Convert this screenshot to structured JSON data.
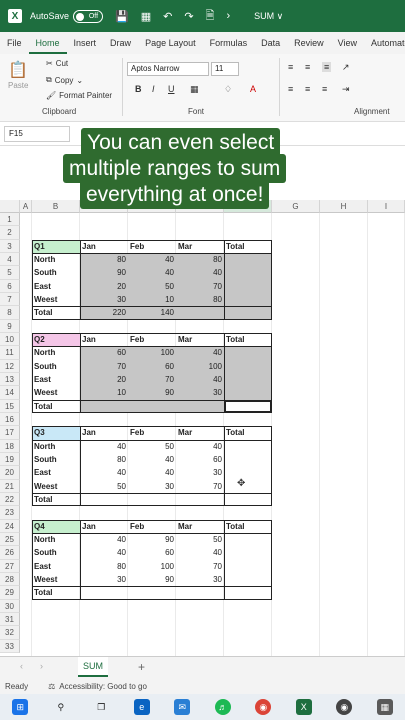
{
  "titlebar": {
    "autosave_label": "AutoSave",
    "autosave_state": "Off",
    "file_name": "SUM ∨"
  },
  "tabs": [
    "File",
    "Home",
    "Insert",
    "Draw",
    "Page Layout",
    "Formulas",
    "Data",
    "Review",
    "View",
    "Automate"
  ],
  "ribbon": {
    "paste": "Paste",
    "cut": "Cut",
    "copy": "Copy",
    "format_painter": "Format Painter",
    "clipboard_label": "Clipboard",
    "font_name": "Aptos Narrow",
    "font_size": "11",
    "font_label": "Font",
    "alignment_label": "Alignment",
    "bold": "B",
    "italic": "I",
    "underline": "U"
  },
  "namebox": "F15",
  "caption": [
    "You can even select",
    "multiple ranges to sum",
    "everything at once!"
  ],
  "columns": [
    "A",
    "B",
    "C",
    "D",
    "E",
    "F",
    "G",
    "H",
    "I"
  ],
  "rows": [
    "1",
    "2",
    "3",
    "4",
    "5",
    "6",
    "7",
    "8",
    "9",
    "10",
    "11",
    "12",
    "13",
    "14",
    "15",
    "16",
    "17",
    "18",
    "19",
    "20",
    "21",
    "22",
    "23",
    "24",
    "25",
    "26",
    "27",
    "28",
    "29",
    "30",
    "31",
    "32",
    "33"
  ],
  "headers": {
    "jan": "Jan",
    "feb": "Feb",
    "mar": "Mar",
    "total": "Total"
  },
  "blocks": [
    {
      "quarter": "Q1",
      "color": "#c6efce",
      "rows": [
        {
          "label": "North",
          "jan": "80",
          "feb": "40",
          "mar": "80"
        },
        {
          "label": "South",
          "jan": "90",
          "feb": "40",
          "mar": "40"
        },
        {
          "label": "East",
          "jan": "20",
          "feb": "50",
          "mar": "70"
        },
        {
          "label": "Weest",
          "jan": "30",
          "feb": "10",
          "mar": "80"
        }
      ],
      "total_row": {
        "label": "Total",
        "jan": "220",
        "feb": "140",
        "mar": ""
      }
    },
    {
      "quarter": "Q2",
      "color": "#f4c6e7",
      "rows": [
        {
          "label": "North",
          "jan": "60",
          "feb": "100",
          "mar": "40"
        },
        {
          "label": "South",
          "jan": "70",
          "feb": "60",
          "mar": "100"
        },
        {
          "label": "East",
          "jan": "20",
          "feb": "70",
          "mar": "40"
        },
        {
          "label": "Weest",
          "jan": "10",
          "feb": "90",
          "mar": "30"
        }
      ],
      "total_row": {
        "label": "Total",
        "jan": "",
        "feb": "",
        "mar": ""
      }
    },
    {
      "quarter": "Q3",
      "color": "#c9e8f7",
      "rows": [
        {
          "label": "North",
          "jan": "40",
          "feb": "50",
          "mar": "40"
        },
        {
          "label": "South",
          "jan": "80",
          "feb": "40",
          "mar": "60"
        },
        {
          "label": "East",
          "jan": "40",
          "feb": "40",
          "mar": "30"
        },
        {
          "label": "Weest",
          "jan": "50",
          "feb": "30",
          "mar": "70"
        }
      ],
      "total_row": {
        "label": "Total",
        "jan": "",
        "feb": "",
        "mar": ""
      }
    },
    {
      "quarter": "Q4",
      "color": "#c6efce",
      "rows": [
        {
          "label": "North",
          "jan": "40",
          "feb": "90",
          "mar": "50"
        },
        {
          "label": "South",
          "jan": "40",
          "feb": "60",
          "mar": "40"
        },
        {
          "label": "East",
          "jan": "80",
          "feb": "100",
          "mar": "70"
        },
        {
          "label": "Weest",
          "jan": "30",
          "feb": "90",
          "mar": "30"
        }
      ],
      "total_row": {
        "label": "Total",
        "jan": "",
        "feb": "",
        "mar": ""
      }
    }
  ],
  "sheet": {
    "name": "SUM",
    "add": "+"
  },
  "status": {
    "ready": "Ready",
    "accessibility": "Accessibility: Good to go"
  }
}
